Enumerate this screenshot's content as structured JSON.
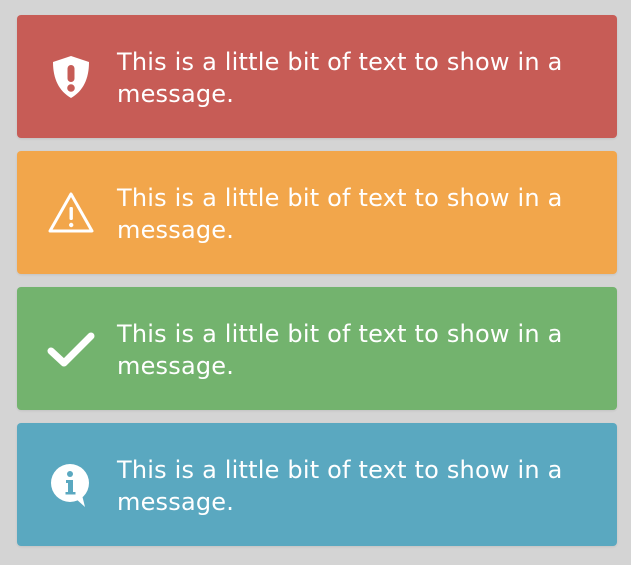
{
  "alerts": [
    {
      "type": "danger",
      "icon": "shield-exclamation-icon",
      "color": "#c75c56",
      "text": "This is a little bit of text to show in a message."
    },
    {
      "type": "warning",
      "icon": "warning-triangle-icon",
      "color": "#f2a64b",
      "text": "This is a little bit of text to show in a message."
    },
    {
      "type": "success",
      "icon": "checkmark-icon",
      "color": "#73b36e",
      "text": "This is a little bit of text to show in a message."
    },
    {
      "type": "info",
      "icon": "info-bubble-icon",
      "color": "#5aa8c0",
      "text": "This is a little bit of text to show in a message."
    }
  ]
}
